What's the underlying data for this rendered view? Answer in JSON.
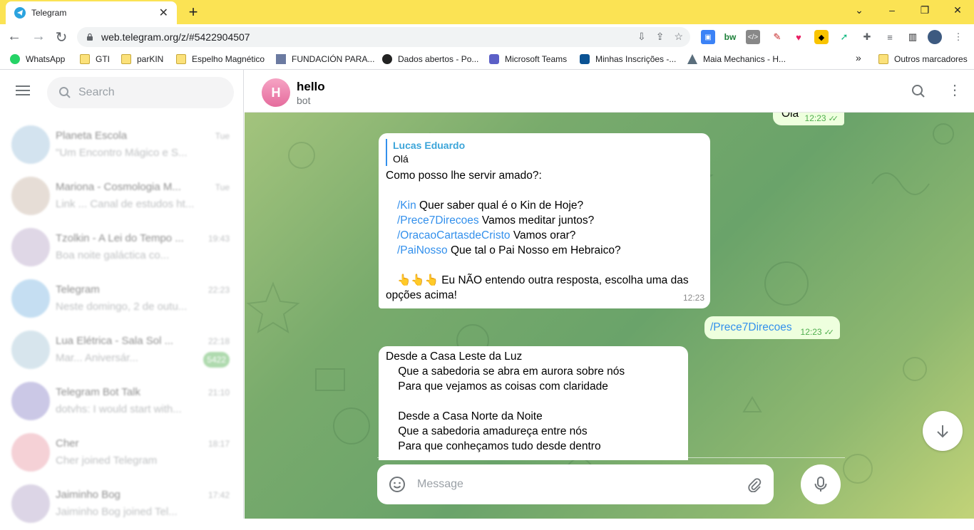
{
  "browser": {
    "tab_title": "Telegram",
    "url": "web.telegram.org/z/#5422904507",
    "bookmarks": [
      {
        "label": "WhatsApp",
        "icon": "whatsapp-icon"
      },
      {
        "label": "GTI",
        "icon": "folder-icon"
      },
      {
        "label": "parKIN",
        "icon": "folder-icon"
      },
      {
        "label": "Espelho Magnético",
        "icon": "folder-icon"
      },
      {
        "label": "FUNDACIÓN PARA...",
        "icon": "site-icon"
      },
      {
        "label": "Dados abertos - Po...",
        "icon": "site-icon"
      },
      {
        "label": "Microsoft Teams",
        "icon": "teams-icon"
      },
      {
        "label": "Minhas Inscrições -...",
        "icon": "site-icon"
      },
      {
        "label": "Maia Mechanics - H...",
        "icon": "site-icon"
      }
    ],
    "bookmarks_overflow": "»",
    "other_bookmarks": "Outros marcadores"
  },
  "sidebar": {
    "search_placeholder": "Search",
    "chats": [
      {
        "name": "Planeta Escola",
        "time": "Tue",
        "preview": "\"Um Encontro Mágico e S...",
        "badge": "",
        "color": "#9ec2dc"
      },
      {
        "name": "Mariona - Cosmologia M...",
        "time": "Tue",
        "preview": "Link ... Canal de estudos ht...",
        "badge": "",
        "color": "#c9b6a6"
      },
      {
        "name": "Tzolkin - A Lei do Tempo ...",
        "time": "19:43",
        "preview": "Boa noite galáctica co...",
        "badge": "",
        "color": "#b9a7c9"
      },
      {
        "name": "Telegram",
        "time": "22:23",
        "preview": "Neste domingo, 2 de outu...",
        "badge": "",
        "color": "#7fb8e3"
      },
      {
        "name": "Lua Elétrica - Sala Sol ...",
        "time": "22:18",
        "preview": "Mar... Aniversár...",
        "badge": "5422",
        "color": "#a7c7d8"
      },
      {
        "name": "Telegram Bot Talk",
        "time": "21:10",
        "preview": "dotvhs: I would start with...",
        "badge": "",
        "color": "#8d86c9"
      },
      {
        "name": "Cher",
        "time": "18:17",
        "preview": "Cher joined Telegram",
        "badge": "",
        "color": "#e99aa6"
      },
      {
        "name": "Jaiminho Bog",
        "time": "17:42",
        "preview": "Jaiminho Bog joined Tel...",
        "badge": "",
        "color": "#b2a4c8"
      }
    ]
  },
  "chat": {
    "peer_initial": "H",
    "peer_name": "hello",
    "peer_status": "bot",
    "messages": {
      "m0": {
        "text": "Olá",
        "time": "12:23"
      },
      "m1": {
        "reply_name": "Lucas Eduardo",
        "reply_text": "Olá",
        "intro": "Como posso lhe servir amado?:",
        "commands": [
          {
            "cmd": "/Kin",
            "desc": " Quer saber qual é o Kin de Hoje?"
          },
          {
            "cmd": "/Prece7Direcoes",
            "desc": " Vamos meditar juntos?"
          },
          {
            "cmd": "/OracaoCartasdeCristo",
            "desc": " Vamos orar?"
          },
          {
            "cmd": "/PaiNosso",
            "desc": " Que tal o Pai Nosso em Hebraico?"
          }
        ],
        "warning_emoji": "👆👆👆",
        "warning": " Eu NÃO entendo outra resposta, escolha uma das",
        "warning2": "opções acima!",
        "time": "12:23"
      },
      "m2": {
        "text": "/Prece7Direcoes",
        "time": "12:23"
      },
      "m3": {
        "lines": [
          "Desde a Casa Leste da Luz",
          "    Que a sabedoria se abra em aurora sobre nós",
          "    Para que vejamos as coisas com claridade",
          "",
          "    Desde a Casa Norte da Noite",
          "    Que a sabedoria amadureça entre nós",
          "    Para que conheçamos tudo desde dentro"
        ]
      }
    },
    "composer_placeholder": "Message"
  },
  "colors": {
    "accent": "#3390ec",
    "outgoing": "#eeffde",
    "read_check": "#4fae4e",
    "tab_bar": "#fbe354"
  }
}
